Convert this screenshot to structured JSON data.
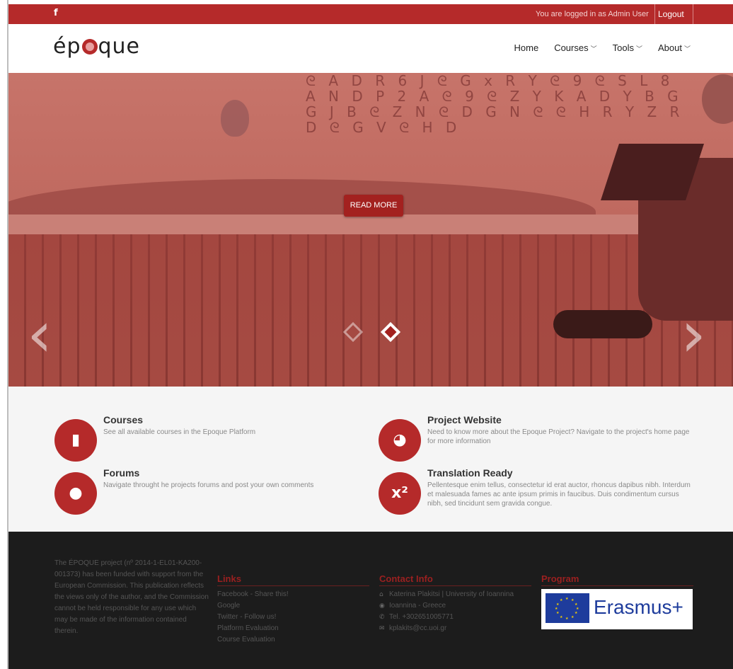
{
  "topbar": {
    "facebook_glyph": "f",
    "logged_in_text": "You are logged in as Admin User",
    "logout_label": "Logout"
  },
  "header": {
    "logo_before": "ép",
    "logo_after": "que",
    "nav": [
      {
        "label": "Home",
        "has_dropdown": false
      },
      {
        "label": "Courses",
        "has_dropdown": true
      },
      {
        "label": "Tools",
        "has_dropdown": true
      },
      {
        "label": "About",
        "has_dropdown": true
      }
    ]
  },
  "hero": {
    "read_more_label": "READ MORE",
    "slides": 2,
    "active_slide": 2,
    "prev_glyph": "‹",
    "next_glyph": "›",
    "letters": "ᘓ A D R 6 J ᘓ G x R Y ᘓ 9 ᘓ S L 8 A N D P 2 A ᘓ 9 ᘓ Z Y K A D Y B G G J B ᘓ Z N ᘓ D G N ᘓ ᘓ H R Y Z R D ᘓ G V ᘓ H D",
    "overlay_color": "#b52a2a"
  },
  "features": [
    {
      "title": "Courses",
      "text": "See all available courses in the Epoque Platform",
      "icon": "book-icon",
      "glyph": "▮"
    },
    {
      "title": "Project Website",
      "text": "Need to know more about the Epoque Project? Navigate to the project's home page for more information",
      "icon": "globe-icon",
      "glyph": "◕"
    },
    {
      "title": "Forums",
      "text": "Navigate throught he projects forums and post your own comments",
      "icon": "comments-icon",
      "glyph": "●"
    },
    {
      "title": "Translation Ready",
      "text": "Pellentesque enim tellus, consectetur id erat auctor, rhoncus dapibus nibh. Interdum et malesuada fames ac ante ipsum primis in faucibus. Duis condimentum cursus nibh, sed tincidunt sem gravida congue.",
      "icon": "superscript-icon",
      "glyph": "x²"
    }
  ],
  "footer": {
    "about": "The ÉPOQUE project (nº 2014-1-EL01-KA200-001373) has been funded with support from the European Commission. This publication reflects the views only of the author, and the Commission cannot be held responsible for any use which may be made of the information contained therein.",
    "links_title": "Links",
    "links": [
      "Facebook - Share this!",
      "Google",
      "Twitter - Follow us!",
      "Platform Evaluation",
      "Course Evaluation"
    ],
    "contact_title": "Contact Info",
    "contact": [
      {
        "icon": "home-icon",
        "glyph": "⌂",
        "text": "Katerina Plakitsi | University of Ioannina"
      },
      {
        "icon": "location-icon",
        "glyph": "◉",
        "text": "Ioannina - Greece"
      },
      {
        "icon": "phone-icon",
        "glyph": "✆",
        "text": "Tel. +302651005771"
      },
      {
        "icon": "email-icon",
        "glyph": "✉",
        "text": "kplakits@cc.uoi.gr"
      }
    ],
    "program_title": "Program",
    "program_logo_text": "Erasmus+"
  },
  "colors": {
    "brand_red": "#b52a2a",
    "button_red": "#a3211f",
    "footer_bg": "#1c1c1c",
    "features_bg": "#f5f5f5"
  }
}
